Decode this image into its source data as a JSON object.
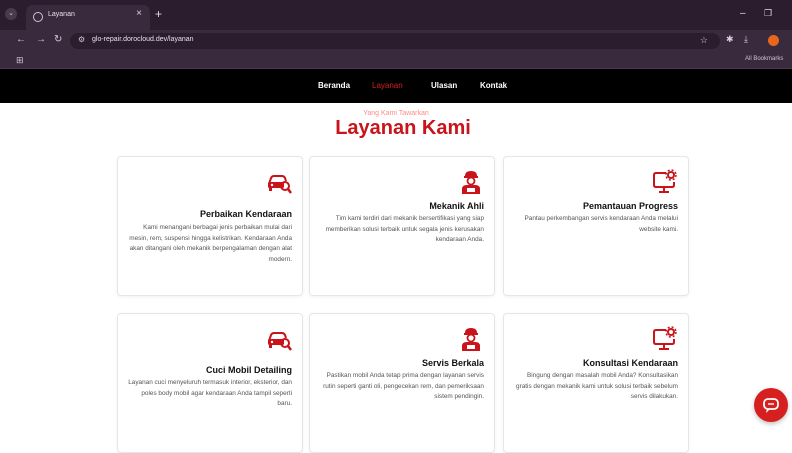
{
  "browser": {
    "tab_title": "Layanan",
    "url": "glo-repair.dorocloud.dev/layanan",
    "all_bookmarks": "All Bookmarks"
  },
  "nav": {
    "items": [
      {
        "label": "Beranda"
      },
      {
        "label": "Layanan"
      },
      {
        "label": "Ulasan"
      },
      {
        "label": "Kontak"
      }
    ]
  },
  "section": {
    "eyebrow": "Yang Kami Tawarkan",
    "title": "Layanan Kami"
  },
  "services": [
    {
      "icon": "car-repair-icon",
      "title": "Perbaikan Kendaraan",
      "description": "Kami menangani berbagai jenis perbaikan mulai dari mesin, rem, suspensi hingga kelistrikan. Kendaraan Anda akan ditangani oleh mekanik berpengalaman dengan alat modern."
    },
    {
      "icon": "mechanic-icon",
      "title": "Mekanik Ahli",
      "description": "Tim kami terdiri dari mekanik bersertifikasi yang siap memberikan solusi terbaik untuk segala jenis kerusakan kendaraan Anda."
    },
    {
      "icon": "monitor-gear-icon",
      "title": "Pemantauan Progress",
      "description": "Pantau perkembangan servis kendaraan Anda melalui website kami."
    },
    {
      "icon": "car-repair-icon",
      "title": "Cuci Mobil Detailing",
      "description": "Layanan cuci menyeluruh termasuk interior, eksterior, dan poles body mobil agar kendaraan Anda tampil seperti baru."
    },
    {
      "icon": "mechanic-icon",
      "title": "Servis Berkala",
      "description": "Pastikan mobil Anda tetap prima dengan layanan servis rutin seperti ganti oli, pengecekan rem, dan pemeriksaan sistem pendingin."
    },
    {
      "icon": "monitor-gear-icon",
      "title": "Konsultasi Kendaraan",
      "description": "Bingung dengan masalah mobil Anda? Konsultasikan gratis dengan mekanik kami untuk solusi terbaik sebelum servis dilakukan."
    }
  ],
  "colors": {
    "accent": "#c8141a",
    "nav_bg": "#000000",
    "browser_frame": "#2b1d2e"
  }
}
